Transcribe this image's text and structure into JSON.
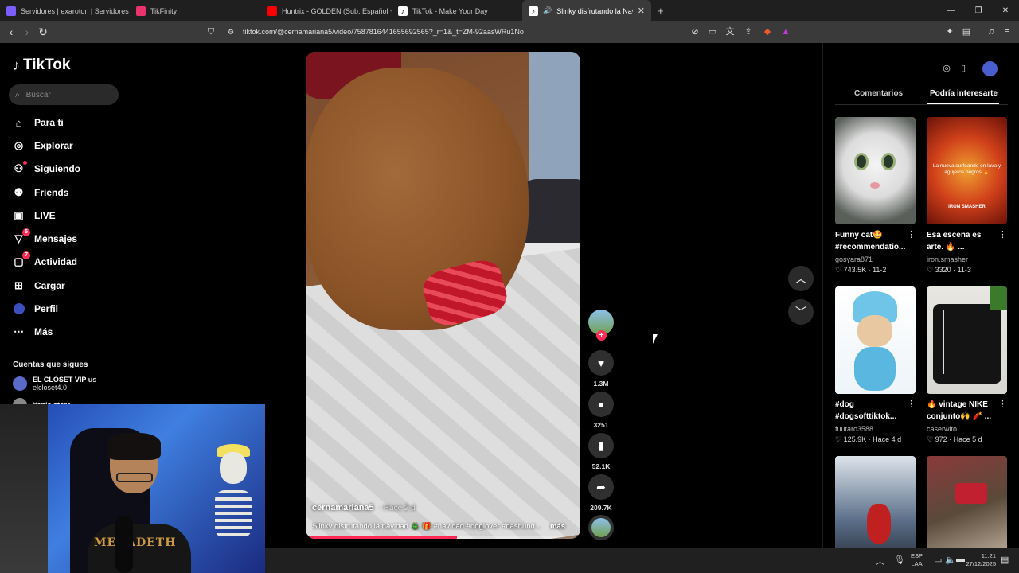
{
  "browser": {
    "tabs": [
      {
        "title": "Servidores | exaroton | Servidores de",
        "color": "#7a5cff"
      },
      {
        "title": "TikFinity",
        "color": "#e8336d"
      },
      {
        "title": "Huntrix - GOLDEN (Sub. Español + Ly",
        "color": "#ff0000"
      },
      {
        "title": "TikTok - Make Your Day",
        "color": "#222222"
      },
      {
        "title": "Slinky disfrutando la Navidad",
        "color": "#222222"
      }
    ],
    "new_tab": "+",
    "url": "tiktok.com/@cernamariana5/video/7587816441655692565?_r=1&_t=ZM-92aasWRu1No",
    "ext_badge": "4"
  },
  "sidebar": {
    "logo": "TikTok",
    "search_placeholder": "Buscar",
    "items": [
      {
        "label": "Para ti",
        "icon": "home-icon",
        "glyph": "⌂"
      },
      {
        "label": "Explorar",
        "icon": "compass-icon",
        "glyph": "◎"
      },
      {
        "label": "Siguiendo",
        "icon": "following-icon",
        "glyph": "👤"
      },
      {
        "label": "Friends",
        "icon": "friends-icon",
        "glyph": "👥"
      },
      {
        "label": "LIVE",
        "icon": "live-icon",
        "glyph": "▣"
      },
      {
        "label": "Mensajes",
        "icon": "messages-icon",
        "glyph": "▽",
        "badge": "5"
      },
      {
        "label": "Actividad",
        "icon": "activity-icon",
        "glyph": "▢",
        "badge": "7"
      },
      {
        "label": "Cargar",
        "icon": "upload-icon",
        "glyph": "⊞"
      },
      {
        "label": "Perfil",
        "icon": "profile-icon",
        "glyph": "●"
      },
      {
        "label": "Más",
        "icon": "more-icon",
        "glyph": "⋯"
      }
    ],
    "following_title": "Cuentas que sigues",
    "accounts": [
      {
        "name": "EL CLÓSET VIP",
        "tag": "us",
        "handle": "elcloset4.0"
      },
      {
        "name": "Yanis store",
        "tag": "",
        "handle": ""
      }
    ]
  },
  "webcam": {
    "shirt_text": "MEGADETH"
  },
  "video": {
    "author": "cernamariana5",
    "time": "· Hace 2 d",
    "description": "Slinky disfrutando la navidad 🎄 🎁 #navidad #doglover #dashund...",
    "more": "más",
    "progress": 0.55
  },
  "actions": {
    "likes": "1.3M",
    "comments": "3251",
    "saves": "52.1K",
    "shares": "209.7K"
  },
  "right_panel": {
    "tabs": [
      "Comentarios",
      "Podría interesarte"
    ],
    "cards": [
      {
        "title": "Funny cat🤩 #recommendatio...",
        "user": "gosyara871",
        "stats": "♡ 743.5K · 11-2"
      },
      {
        "title": "Esa escena es arte. 🔥 ...",
        "user": "iron.smasher",
        "stats": "♡ 3320 · 11-3",
        "overlay": "La nueva surfeando en lava y agujeros negros 🔥",
        "overlay2": "IRON SMASHER"
      },
      {
        "title": "#dog #dogsofttiktok...",
        "user": "fuutaro3588",
        "stats": "♡ 125.9K · Hace 4 d"
      },
      {
        "title": "🔥 vintage NIKE conjunto🙌 🧨 ...",
        "user": "caserwito",
        "stats": "♡ 972 · Hace 5 d"
      }
    ]
  },
  "taskbar": {
    "lang1": "ESP",
    "lang2": "LAA",
    "time": "11:21",
    "date": "27/12/2025"
  }
}
